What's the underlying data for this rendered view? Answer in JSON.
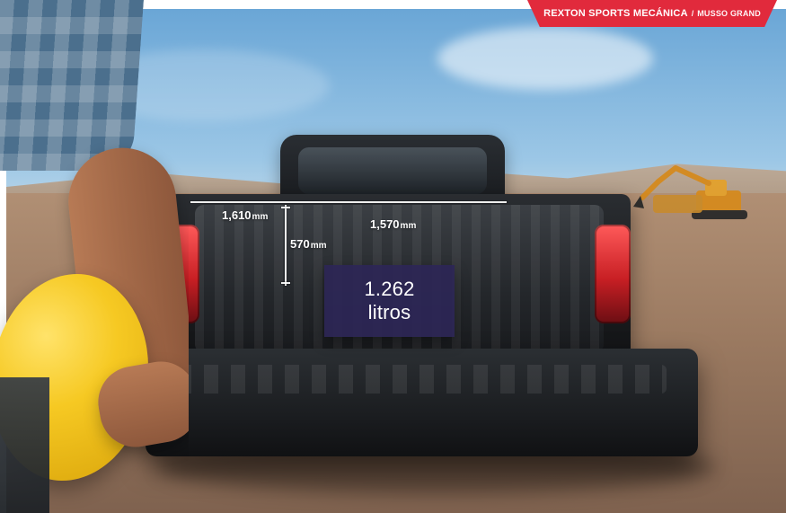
{
  "banner": {
    "title": "REXTON SPORTS MECÁNICA",
    "separator": "/",
    "subtitle": "MUSSO GRAND",
    "accent_color": "#e12a3c"
  },
  "dimensions": {
    "width_1": "1,610",
    "width_2": "1,570",
    "height": "570",
    "unit": "mm"
  },
  "volume": {
    "value": "1.262",
    "unit": "litros",
    "bg_color": "#2c2656"
  }
}
